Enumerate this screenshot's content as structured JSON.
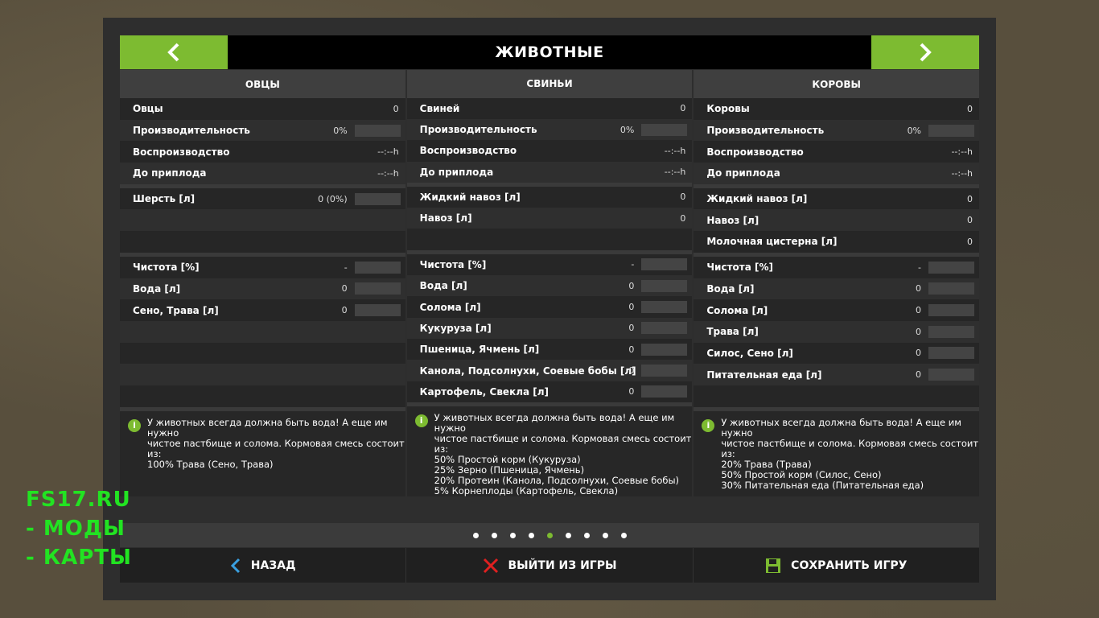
{
  "header": {
    "title": "ЖИВОТНЫЕ"
  },
  "columns": [
    {
      "title": "ОВЦЫ",
      "stats": [
        {
          "label": "Овцы",
          "value": "0",
          "bar": false
        },
        {
          "label": "Производительность",
          "value": "0%",
          "bar": true
        },
        {
          "label": "Воспроизводство",
          "value": "--:--h",
          "bar": false
        },
        {
          "label": "До приплода",
          "value": "--:--h",
          "bar": false
        }
      ],
      "products": [
        {
          "label": "Шерсть [л]",
          "value": "0 (0%)",
          "bar": true
        },
        {
          "label": "",
          "value": "",
          "bar": false
        },
        {
          "label": "",
          "value": "",
          "bar": false
        }
      ],
      "food": [
        {
          "label": "Чистота [%]",
          "value": "-",
          "bar": true
        },
        {
          "label": "Вода [л]",
          "value": "0",
          "bar": true
        },
        {
          "label": "Сено, Трава [л]",
          "value": "0",
          "bar": true
        },
        {
          "label": "",
          "value": "",
          "bar": false
        },
        {
          "label": "",
          "value": "",
          "bar": false
        },
        {
          "label": "",
          "value": "",
          "bar": false
        },
        {
          "label": "",
          "value": "",
          "bar": false
        }
      ],
      "info": "У животных всегда должна быть вода! А еще им нужно\nчистое пастбище и солома. Кормовая смесь состоит\nиз:\n100% Трава (Сено, Трава)"
    },
    {
      "title": "СВИНЬИ",
      "stats": [
        {
          "label": "Свиней",
          "value": "0",
          "bar": false
        },
        {
          "label": "Производительность",
          "value": "0%",
          "bar": true
        },
        {
          "label": "Воспроизводство",
          "value": "--:--h",
          "bar": false
        },
        {
          "label": "До приплода",
          "value": "--:--h",
          "bar": false
        }
      ],
      "products": [
        {
          "label": "Жидкий навоз [л]",
          "value": "0",
          "bar": false
        },
        {
          "label": "Навоз [л]",
          "value": "0",
          "bar": false
        },
        {
          "label": "",
          "value": "",
          "bar": false
        }
      ],
      "food": [
        {
          "label": "Чистота [%]",
          "value": "-",
          "bar": true
        },
        {
          "label": "Вода [л]",
          "value": "0",
          "bar": true
        },
        {
          "label": "Солома [л]",
          "value": "0",
          "bar": true
        },
        {
          "label": "Кукуруза [л]",
          "value": "0",
          "bar": true
        },
        {
          "label": "Пшеница, Ячмень [л]",
          "value": "0",
          "bar": true
        },
        {
          "label": "Канола, Подсолнухи, Соевые бобы [л]",
          "value": "0",
          "bar": true
        },
        {
          "label": "Картофель, Свекла [л]",
          "value": "0",
          "bar": true
        }
      ],
      "info": "У животных всегда должна быть вода! А еще им нужно\nчистое пастбище и солома. Кормовая смесь состоит\nиз:\n50% Простой корм (Кукуруза)\n25% Зерно (Пшеница, Ячмень)\n20% Протеин (Канола, Подсолнухи, Соевые бобы)\n5% Корнеплоды (Картофель, Свекла)"
    },
    {
      "title": "КОРОВЫ",
      "stats": [
        {
          "label": "Коровы",
          "value": "0",
          "bar": false
        },
        {
          "label": "Производительность",
          "value": "0%",
          "bar": true
        },
        {
          "label": "Воспроизводство",
          "value": "--:--h",
          "bar": false
        },
        {
          "label": "До приплода",
          "value": "--:--h",
          "bar": false
        }
      ],
      "products": [
        {
          "label": "Жидкий навоз [л]",
          "value": "0",
          "bar": false
        },
        {
          "label": "Навоз [л]",
          "value": "0",
          "bar": false
        },
        {
          "label": "Молочная цистерна [л]",
          "value": "0",
          "bar": false
        }
      ],
      "food": [
        {
          "label": "Чистота [%]",
          "value": "-",
          "bar": true
        },
        {
          "label": "Вода [л]",
          "value": "0",
          "bar": true
        },
        {
          "label": "Солома [л]",
          "value": "0",
          "bar": true
        },
        {
          "label": "Трава [л]",
          "value": "0",
          "bar": true
        },
        {
          "label": "Силос, Сено [л]",
          "value": "0",
          "bar": true
        },
        {
          "label": "Питательная еда [л]",
          "value": "0",
          "bar": true
        },
        {
          "label": "",
          "value": "",
          "bar": false
        }
      ],
      "info": "У животных всегда должна быть вода! А еще им нужно\nчистое пастбище и солома. Кормовая смесь состоит\nиз:\n20% Трава (Трава)\n50% Простой корм (Силос, Сено)\n30% Питательная еда (Питательная еда)"
    }
  ],
  "pager": {
    "count": 9,
    "active": 4
  },
  "footer": {
    "back_label": "НАЗАД",
    "quit_label": "ВЫЙТИ ИЗ ИГРЫ",
    "save_label": "СОХРАНИТЬ ИГРУ"
  },
  "watermark": {
    "line1": "FS17.RU",
    "line2": "- МОДЫ",
    "line3": "- КАРТЫ"
  },
  "colors": {
    "accent": "#7dbb31",
    "quit": "#e02020",
    "back_icon": "#3aa0e0"
  }
}
